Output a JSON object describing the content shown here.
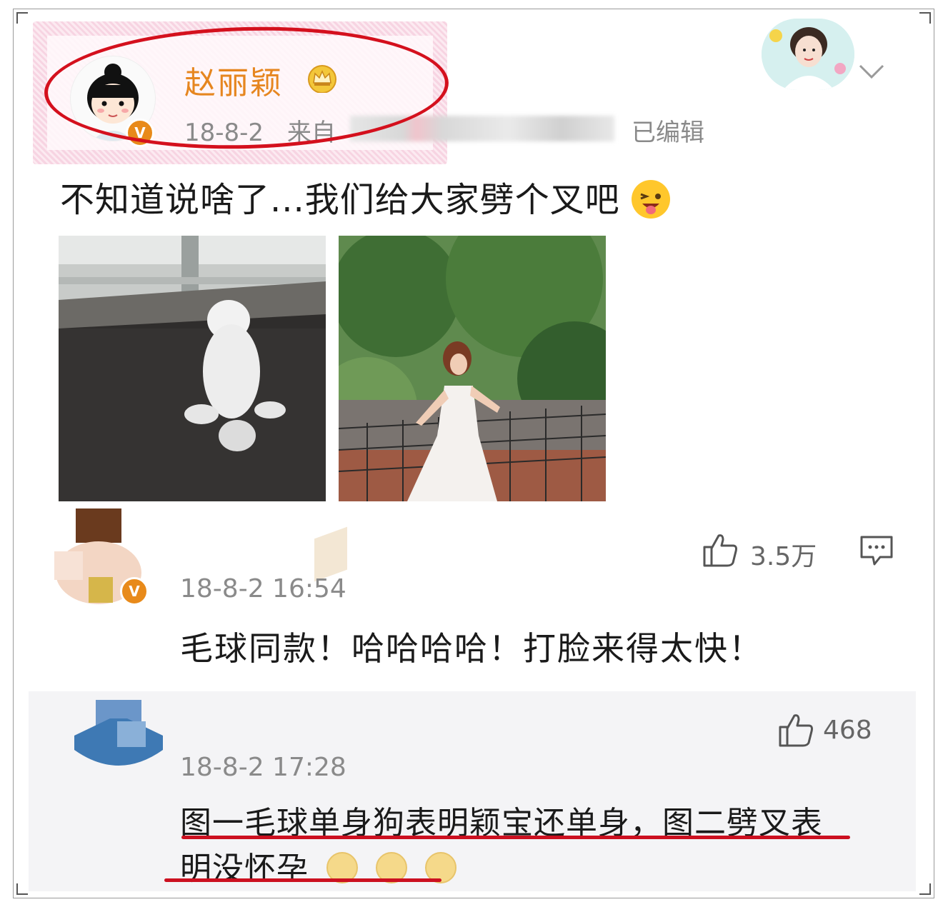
{
  "post": {
    "username": "赵丽颖",
    "date": "18-8-2",
    "source_prefix": "来自",
    "edited": "已编辑",
    "text": "不知道说啥了...我们给大家劈个叉吧",
    "like_count": "3.5万"
  },
  "comments": [
    {
      "time": "18-8-2 16:54",
      "text": "毛球同款！哈哈哈哈！打脸来得太快！",
      "like_count": "468"
    },
    {
      "time": "18-8-2 17:28",
      "text_line1": "图一毛球单身狗表明颖宝还单身，图二劈叉表",
      "text_line2": "明没怀孕"
    }
  ],
  "icons": {
    "verified": "verified-v-badge",
    "crown": "crown-icon",
    "like": "thumbs-up-icon",
    "comment": "comment-icon",
    "chevron": "chevron-down-icon",
    "emoji": "tongue-wink-emoji",
    "doge": "doge-emoji"
  },
  "colors": {
    "username": "#e6861f",
    "highlight": "#d4101d",
    "meta": "#8a8a8a"
  }
}
